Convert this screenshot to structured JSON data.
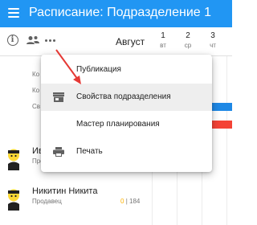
{
  "app": {
    "title": "Расписание: Подразделение 1"
  },
  "calendar": {
    "month": "Август",
    "days": [
      {
        "num": "1",
        "dow": "вт"
      },
      {
        "num": "2",
        "dow": "ср"
      },
      {
        "num": "3",
        "dow": "чт"
      }
    ]
  },
  "background_rows": [
    "Ко",
    "Ко",
    "Св"
  ],
  "menu": {
    "items": [
      {
        "label": "Публикация",
        "icon": ""
      },
      {
        "label": "Свойства подразделения",
        "icon": "store-icon"
      },
      {
        "label": "Мастер планирования",
        "icon": ""
      },
      {
        "label": "Печать",
        "icon": "print-icon"
      }
    ]
  },
  "employees": [
    {
      "name": "Ив",
      "role": "Продав",
      "stats_zero": "",
      "stats_hours": ""
    },
    {
      "name": "Никитин Никита",
      "role": "Продавец",
      "stats_zero": "0",
      "stats_hours": "184"
    }
  ],
  "colors": {
    "appbar": "#2196f3",
    "shift_blue": "#1e88e5",
    "shift_red": "#f44336",
    "arrow": "#e53935"
  }
}
